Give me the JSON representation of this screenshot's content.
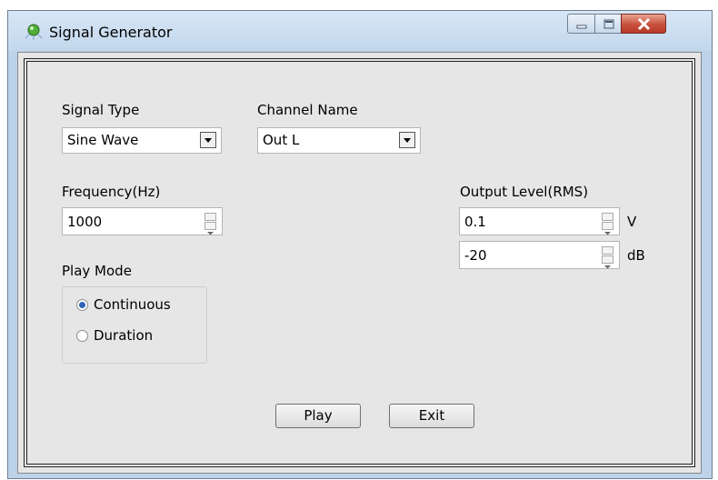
{
  "window": {
    "title": "Signal Generator",
    "icon": "green-gem-icon",
    "controls": [
      "minimize-icon",
      "maximize-icon",
      "close-icon"
    ]
  },
  "signal_type": {
    "label": "Signal Type",
    "value": "Sine Wave"
  },
  "channel_name": {
    "label": "Channel Name",
    "value": "Out L"
  },
  "frequency": {
    "label": "Frequency(Hz)",
    "value": "1000"
  },
  "output_level": {
    "label": "Output Level(RMS)",
    "volts": {
      "value": "0.1",
      "unit": "V"
    },
    "db": {
      "value": "-20",
      "unit": "dB"
    }
  },
  "play_mode": {
    "label": "Play Mode",
    "options": [
      {
        "label": "Continuous",
        "selected": true
      },
      {
        "label": "Duration",
        "selected": false
      }
    ]
  },
  "buttons": {
    "play": "Play",
    "exit": "Exit"
  },
  "colors": {
    "radio_selected": "#2f64b5",
    "close_button": "#c7503c",
    "dialog_bg": "#e6e6e6"
  }
}
